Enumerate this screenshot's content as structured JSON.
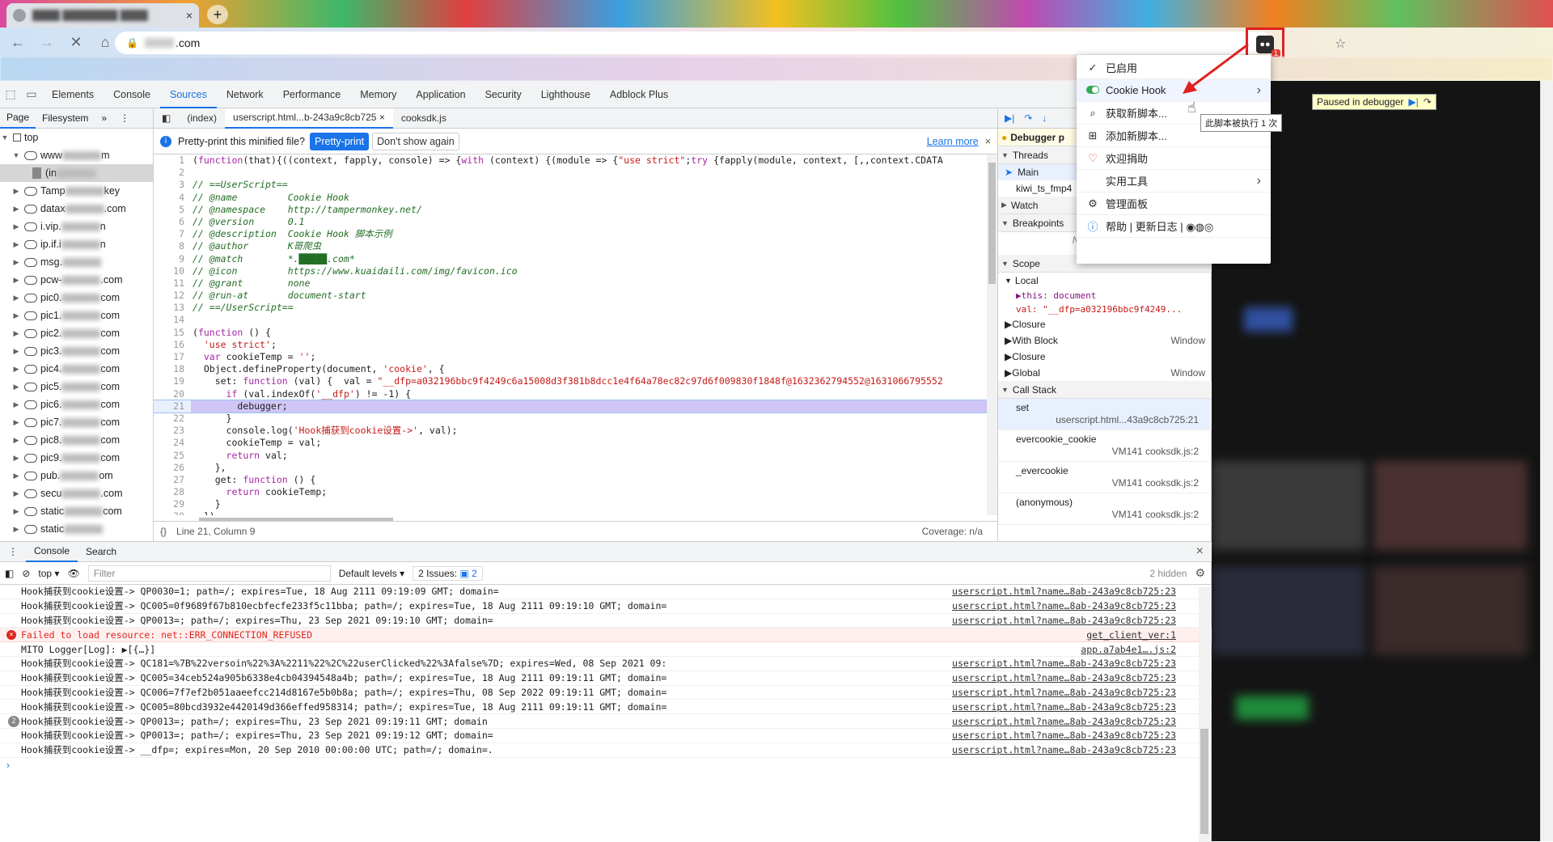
{
  "browser": {
    "tab_title": "████ ████████ ████",
    "tab_close": "×",
    "new_tab": "+",
    "url_suffix": ".com",
    "extension_badge": "1"
  },
  "devtools": {
    "tabs": [
      "Elements",
      "Console",
      "Sources",
      "Network",
      "Performance",
      "Memory",
      "Application",
      "Security",
      "Lighthouse",
      "Adblock Plus"
    ],
    "selected_tab": "Sources",
    "navigator": {
      "tabs": [
        "Page",
        "Filesystem"
      ],
      "more": "»",
      "root": "top",
      "items": [
        {
          "prefix": "www",
          "suffix": "m"
        },
        {
          "prefix": "(in",
          "suffix": ""
        },
        {
          "prefix": "Tamp",
          "suffix": "key"
        },
        {
          "prefix": "datax",
          "suffix": ".com"
        },
        {
          "prefix": "i.vip.",
          "suffix": "n"
        },
        {
          "prefix": "ip.if.i",
          "suffix": "n"
        },
        {
          "prefix": "msg.",
          "suffix": ""
        },
        {
          "prefix": "pcw-",
          "suffix": ".com"
        },
        {
          "prefix": "pic0.",
          "suffix": "com"
        },
        {
          "prefix": "pic1.",
          "suffix": "com"
        },
        {
          "prefix": "pic2.",
          "suffix": "com"
        },
        {
          "prefix": "pic3.",
          "suffix": "com"
        },
        {
          "prefix": "pic4.",
          "suffix": "com"
        },
        {
          "prefix": "pic5.",
          "suffix": "com"
        },
        {
          "prefix": "pic6.",
          "suffix": "com"
        },
        {
          "prefix": "pic7.",
          "suffix": "com"
        },
        {
          "prefix": "pic8.",
          "suffix": "com"
        },
        {
          "prefix": "pic9.",
          "suffix": "com"
        },
        {
          "prefix": "pub.",
          "suffix": "om"
        },
        {
          "prefix": "secu",
          "suffix": ".com"
        },
        {
          "prefix": "static",
          "suffix": "com"
        },
        {
          "prefix": "static",
          "suffix": ""
        }
      ]
    },
    "editor": {
      "tabs": [
        "(index)",
        "userscript.html...b-243a9c8cb725",
        "cooksdk.js"
      ],
      "selected_tab": "userscript.html...b-243a9c8cb725",
      "prettyprint": {
        "question": "Pretty-print this minified file?",
        "button": "Pretty-print",
        "dismiss": "Don't show again",
        "learn": "Learn more"
      },
      "lines": [
        "(function(that){((context, fapply, console) => {with (context) {(module => {\"use strict\";try {fapply(module, context, [,,context.CDATA",
        "",
        "// ==UserScript==",
        "// @name         Cookie Hook",
        "// @namespace    http://tampermonkey.net/",
        "// @version      0.1",
        "// @description  Cookie Hook 脚本示例",
        "// @author       K哥爬虫",
        "// @match        *.█████.com*",
        "// @icon         https://www.kuaidaili.com/img/favicon.ico",
        "// @grant        none",
        "// @run-at       document-start",
        "// ==/UserScript==",
        "",
        "(function () {",
        "  'use strict';",
        "  var cookieTemp = '';",
        "  Object.defineProperty(document, 'cookie', {",
        "    set: function (val) {  val = \"__dfp=a032196bbc9f4249c6a15008d3f381b8dcc1e4f64a78ec82c97d6f009830f1848f@1632362794552@1631066795552",
        "      if (val.indexOf('__dfp') != -1) {",
        "        debugger;",
        "      }",
        "      console.log('Hook捕获到cookie设置->', val);",
        "      cookieTemp = val;",
        "      return val;",
        "    },",
        "    get: function () {",
        "      return cookieTemp;",
        "    }",
        "  })"
      ],
      "current_line": 21,
      "footer_pos": "Line 21, Column 9",
      "footer_cov": "Coverage: n/a"
    },
    "debugger": {
      "paused_label": "Debugger p",
      "threads": "Threads",
      "thread_main": "Main",
      "thread_other": "kiwi_ts_fmp4",
      "watch": "Watch",
      "breakpoints": "Breakpoints",
      "no_breakpoints": "No breakpoints",
      "scope": "Scope",
      "local": "Local",
      "this_val": "this: document",
      "val_val": "val: \"__dfp=a032196bbc9f4249...",
      "closure1": "Closure",
      "with_block": "With Block",
      "window1": "Window",
      "closure2": "Closure",
      "global": "Global",
      "window2": "Window",
      "call_stack": "Call Stack",
      "frames": [
        {
          "fn": "set",
          "loc": "userscript.html...43a9c8cb725:21"
        },
        {
          "fn": "evercookie_cookie",
          "loc": "VM141 cooksdk.js:2"
        },
        {
          "fn": "_evercookie",
          "loc": "VM141 cooksdk.js:2"
        },
        {
          "fn": "(anonymous)",
          "loc": "VM141 cooksdk.js:2"
        }
      ]
    },
    "drawer": {
      "tabs": [
        "Console",
        "Search"
      ],
      "context": "top",
      "filter_placeholder": "Filter",
      "levels": "Default levels",
      "issues_label": "2 Issues:",
      "issues_count": "2",
      "hidden": "2 hidden",
      "logs": [
        {
          "type": "log",
          "msg": "Hook捕获到cookie设置-> QP0030=1; path=/; expires=Tue, 18 Aug 2111 09:19:09 GMT; domain=",
          "src": "userscript.html?name…8ab-243a9c8cb725:23"
        },
        {
          "type": "log",
          "msg": "Hook捕获到cookie设置-> QC005=0f9689f67b810ecbfecfe233f5c11bba; path=/; expires=Tue, 18 Aug 2111 09:19:10 GMT; domain=",
          "src": "userscript.html?name…8ab-243a9c8cb725:23"
        },
        {
          "type": "log",
          "msg": "Hook捕获到cookie设置-> QP0013=; path=/; expires=Thu, 23 Sep 2021 09:19:10 GMT; domain=",
          "src": "userscript.html?name…8ab-243a9c8cb725:23"
        },
        {
          "type": "error",
          "msg": "Failed to load resource: net::ERR_CONNECTION_REFUSED",
          "src": "get_client_ver:1"
        },
        {
          "type": "log",
          "msg": "MITO Logger[Log]: ▶[{…}]",
          "src": "app.a7ab4e1….js:2"
        },
        {
          "type": "log",
          "msg": "Hook捕获到cookie设置-> QC181=%7B%22versoin%22%3A%2211%22%2C%22userClicked%22%3Afalse%7D; expires=Wed, 08 Sep 2021 09:",
          "src": "userscript.html?name…8ab-243a9c8cb725:23"
        },
        {
          "type": "log",
          "msg": "Hook捕获到cookie设置-> QC005=34ceb524a905b6338e4cb04394548a4b; path=/; expires=Tue, 18 Aug 2111 09:19:11 GMT; domain=",
          "src": "userscript.html?name…8ab-243a9c8cb725:23"
        },
        {
          "type": "log",
          "msg": "Hook捕获到cookie设置-> QC006=7f7ef2b051aaeefcc214d8167e5b0b8a; path=/; expires=Thu, 08 Sep 2022 09:19:11 GMT; domain=",
          "src": "userscript.html?name…8ab-243a9c8cb725:23"
        },
        {
          "type": "log",
          "msg": "Hook捕获到cookie设置-> QC005=80bcd3932e4420149d366effed958314; path=/; expires=Tue, 18 Aug 2111 09:19:11 GMT; domain=",
          "src": "userscript.html?name…8ab-243a9c8cb725:23"
        },
        {
          "type": "group",
          "count": "2",
          "msg": "Hook捕获到cookie设置-> QP0013=; path=/; expires=Thu, 23 Sep 2021 09:19:11 GMT; domain",
          "src": "userscript.html?name…8ab-243a9c8cb725:23"
        },
        {
          "type": "log",
          "msg": "Hook捕获到cookie设置-> QP0013=; path=/; expires=Thu, 23 Sep 2021 09:19:12 GMT; domain=",
          "src": "userscript.html?name…8ab-243a9c8cb725:23"
        },
        {
          "type": "log",
          "msg": "Hook捕获到cookie设置-> __dfp=; expires=Mon, 20 Sep 2010 00:00:00 UTC; path=/; domain=.",
          "src": "userscript.html?name…8ab-243a9c8cb725:23"
        }
      ],
      "prompt": "›"
    }
  },
  "ext_menu": {
    "items": [
      {
        "icon": "✓",
        "label": "已启用",
        "arrow": ""
      },
      {
        "icon": "toggle",
        "label": "Cookie Hook",
        "arrow": "›"
      },
      {
        "icon": "⌕",
        "label": "获取新脚本...",
        "arrow": ""
      },
      {
        "icon": "⊞",
        "label": "添加新脚本...",
        "arrow": ""
      },
      {
        "icon": "♡",
        "label": "欢迎捐助",
        "arrow": ""
      },
      {
        "icon": "",
        "label": "实用工具",
        "arrow": "›"
      },
      {
        "icon": "⚙",
        "label": "管理面板",
        "arrow": ""
      },
      {
        "icon": "ⓘ",
        "label": "帮助 | 更新日志 | ◉◍◎",
        "arrow": ""
      }
    ],
    "tooltip": "此脚本被执行 1 次"
  },
  "paused_overlay": {
    "label": "Paused in debugger"
  },
  "colors": {
    "accent": "#1a73e8",
    "error": "#e0261e",
    "highlight_box": "#e02020"
  }
}
